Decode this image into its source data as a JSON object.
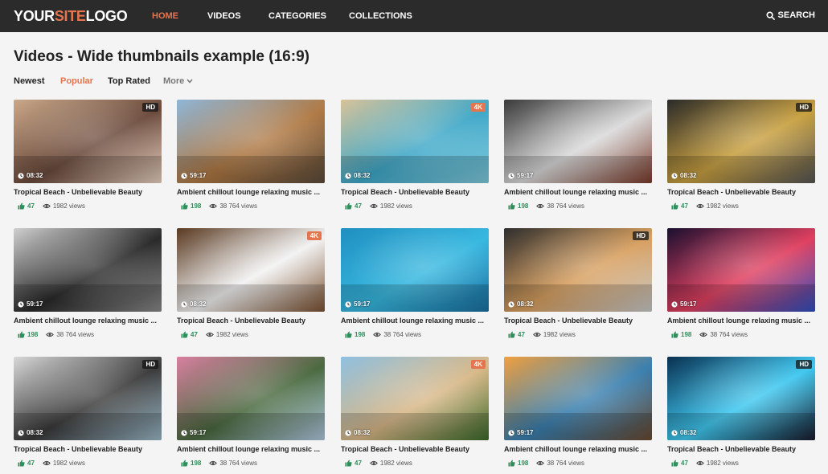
{
  "header": {
    "logo": {
      "part1": "YOUR",
      "part2": "SITE",
      "part3": "LOGO"
    },
    "nav": [
      "HOME",
      "VIDEOS",
      "CATEGORIES",
      "COLLECTIONS"
    ],
    "search_label": "SEARCH"
  },
  "page_title": "Videos - Wide thumbnails example (16:9)",
  "tabs": [
    "Newest",
    "Popular",
    "Top Rated",
    "More"
  ],
  "videos": [
    {
      "title": "Tropical Beach - Unbelievable Beauty",
      "duration": "08:32",
      "badge": "HD",
      "likes": "47",
      "views": "1982 views"
    },
    {
      "title": "Ambient chillout lounge relaxing music ...",
      "duration": "59:17",
      "badge": "",
      "likes": "198",
      "views": "38 764 views"
    },
    {
      "title": "Tropical Beach - Unbelievable Beauty",
      "duration": "08:32",
      "badge": "4K",
      "likes": "47",
      "views": "1982 views"
    },
    {
      "title": "Ambient chillout lounge relaxing music ...",
      "duration": "59:17",
      "badge": "",
      "likes": "198",
      "views": "38 764 views"
    },
    {
      "title": "Tropical Beach - Unbelievable Beauty",
      "duration": "08:32",
      "badge": "HD",
      "likes": "47",
      "views": "1982 views"
    },
    {
      "title": "Ambient chillout lounge relaxing music ...",
      "duration": "59:17",
      "badge": "",
      "likes": "198",
      "views": "38 764 views"
    },
    {
      "title": "Tropical Beach - Unbelievable Beauty",
      "duration": "08:32",
      "badge": "4K",
      "likes": "47",
      "views": "1982 views"
    },
    {
      "title": "Ambient chillout lounge relaxing music ...",
      "duration": "59:17",
      "badge": "",
      "likes": "198",
      "views": "38 764 views"
    },
    {
      "title": "Tropical Beach - Unbelievable Beauty",
      "duration": "08:32",
      "badge": "HD",
      "likes": "47",
      "views": "1982 views"
    },
    {
      "title": "Ambient chillout lounge relaxing music ...",
      "duration": "59:17",
      "badge": "",
      "likes": "198",
      "views": "38 764 views"
    },
    {
      "title": "Tropical Beach - Unbelievable Beauty",
      "duration": "08:32",
      "badge": "HD",
      "likes": "47",
      "views": "1982 views"
    },
    {
      "title": "Ambient chillout lounge relaxing music ...",
      "duration": "59:17",
      "badge": "",
      "likes": "198",
      "views": "38 764 views"
    },
    {
      "title": "Tropical Beach - Unbelievable Beauty",
      "duration": "08:32",
      "badge": "4K",
      "likes": "47",
      "views": "1982 views"
    },
    {
      "title": "Ambient chillout lounge relaxing music ...",
      "duration": "59:17",
      "badge": "",
      "likes": "198",
      "views": "38 764 views"
    },
    {
      "title": "Tropical Beach - Unbelievable Beauty",
      "duration": "08:32",
      "badge": "HD",
      "likes": "47",
      "views": "1982 views"
    }
  ],
  "colors": {
    "accent": "#e5754e",
    "header_bg": "#2b2b2b",
    "likes": "#2f8f5b"
  }
}
